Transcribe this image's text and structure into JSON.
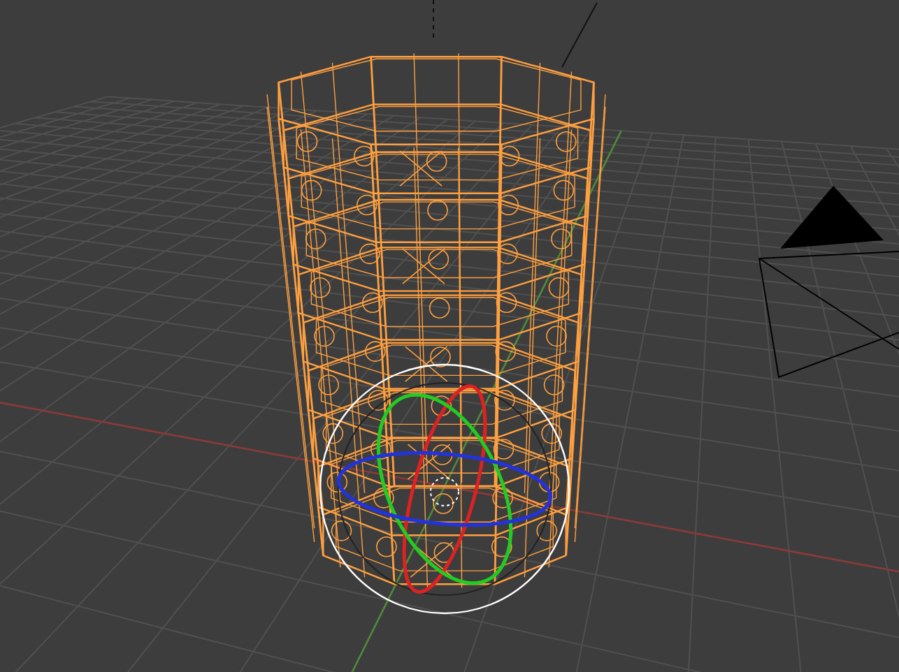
{
  "viewport": {
    "wireframe": true,
    "rotate_gizmo": true
  }
}
